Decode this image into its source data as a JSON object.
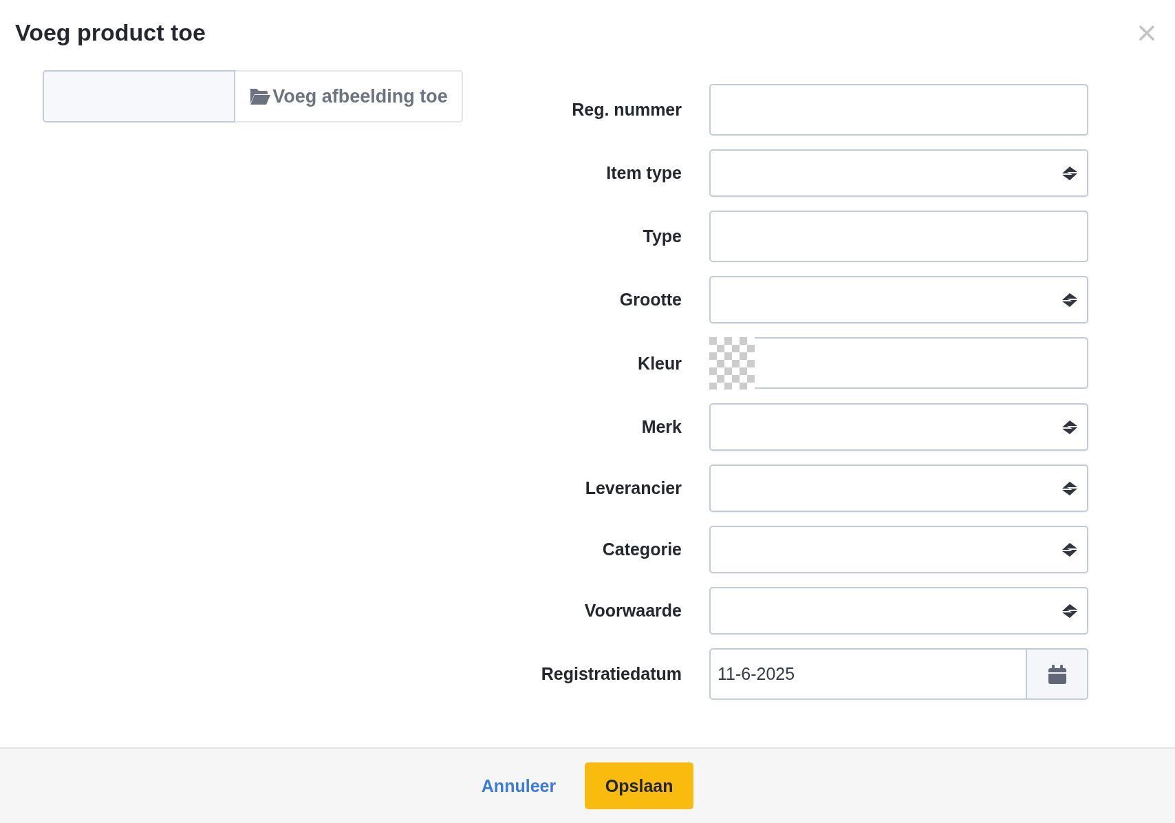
{
  "dialog": {
    "title": "Voeg product toe"
  },
  "image_upload": {
    "button": "Voeg afbeelding toe"
  },
  "fields": [
    {
      "label": "Reg. nummer",
      "kind": "text"
    },
    {
      "label": "Item type",
      "kind": "select"
    },
    {
      "label": "Type",
      "kind": "text"
    },
    {
      "label": "Grootte",
      "kind": "select"
    },
    {
      "label": "Kleur",
      "kind": "color"
    },
    {
      "label": "Merk",
      "kind": "select"
    },
    {
      "label": "Leverancier",
      "kind": "select"
    },
    {
      "label": "Categorie",
      "kind": "select"
    },
    {
      "label": "Voorwaarde",
      "kind": "select"
    },
    {
      "label": "Registratiedatum",
      "kind": "date",
      "value": "11-6-2025"
    }
  ],
  "footer": {
    "cancel": "Annuleer",
    "save": "Opslaan"
  }
}
